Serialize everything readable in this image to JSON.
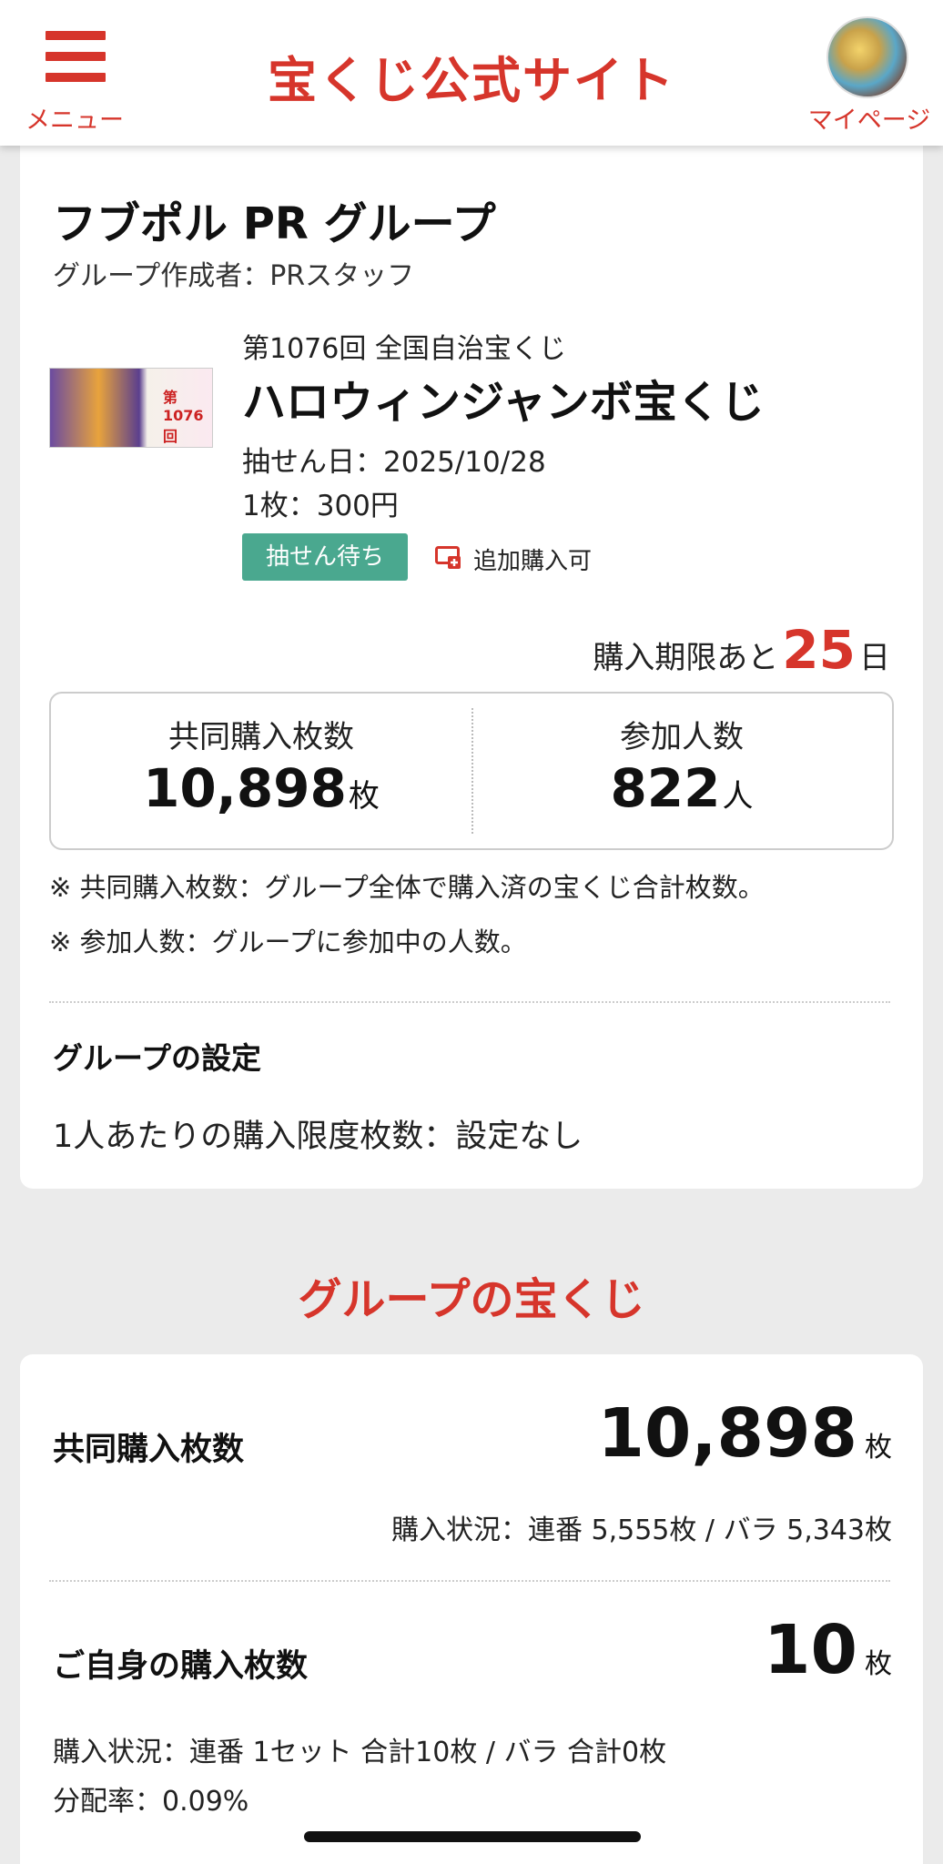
{
  "header": {
    "menu_label": "メニュー",
    "title": "宝くじ公式サイト",
    "mypage_label": "マイページ",
    "accent_color": "#d6352b"
  },
  "group": {
    "name": "フブポル PR グループ",
    "creator": "グループ作成者：PRスタッフ"
  },
  "lottery": {
    "round": "第1076回 全国自治宝くじ",
    "name": "ハロウィンジャンボ宝くじ",
    "draw_date": "抽せん日：2025/10/28",
    "price": "1枚：300円",
    "status": "抽せん待ち",
    "add_purchase": "追加購入可",
    "ticket_image_text": "第1076回"
  },
  "deadline": {
    "prefix": "購入期限あと",
    "days": "25",
    "suffix": "日"
  },
  "stats": {
    "joint_label": "共同購入枚数",
    "joint_value": "10,898",
    "joint_unit": "枚",
    "members_label": "参加人数",
    "members_value": "822",
    "members_unit": "人"
  },
  "notes": [
    "※ 共同購入枚数：グループ全体で購入済の宝くじ合計枚数。",
    "※ 参加人数：グループに参加中の人数。"
  ],
  "settings": {
    "title": "グループの設定",
    "limit": "1人あたりの購入限度枚数：設定なし"
  },
  "group_lottery": {
    "section_title": "グループの宝くじ",
    "joint_label": "共同購入枚数",
    "joint_value": "10,898",
    "joint_unit": "枚",
    "joint_detail": "購入状況：連番 5,555枚 / バラ 5,343枚",
    "own_label": "ご自身の購入枚数",
    "own_value": "10",
    "own_unit": "枚",
    "own_detail": "購入状況：連番 1セット 合計10枚 / バラ 合計0枚",
    "own_rate": "分配率：0.09%"
  }
}
